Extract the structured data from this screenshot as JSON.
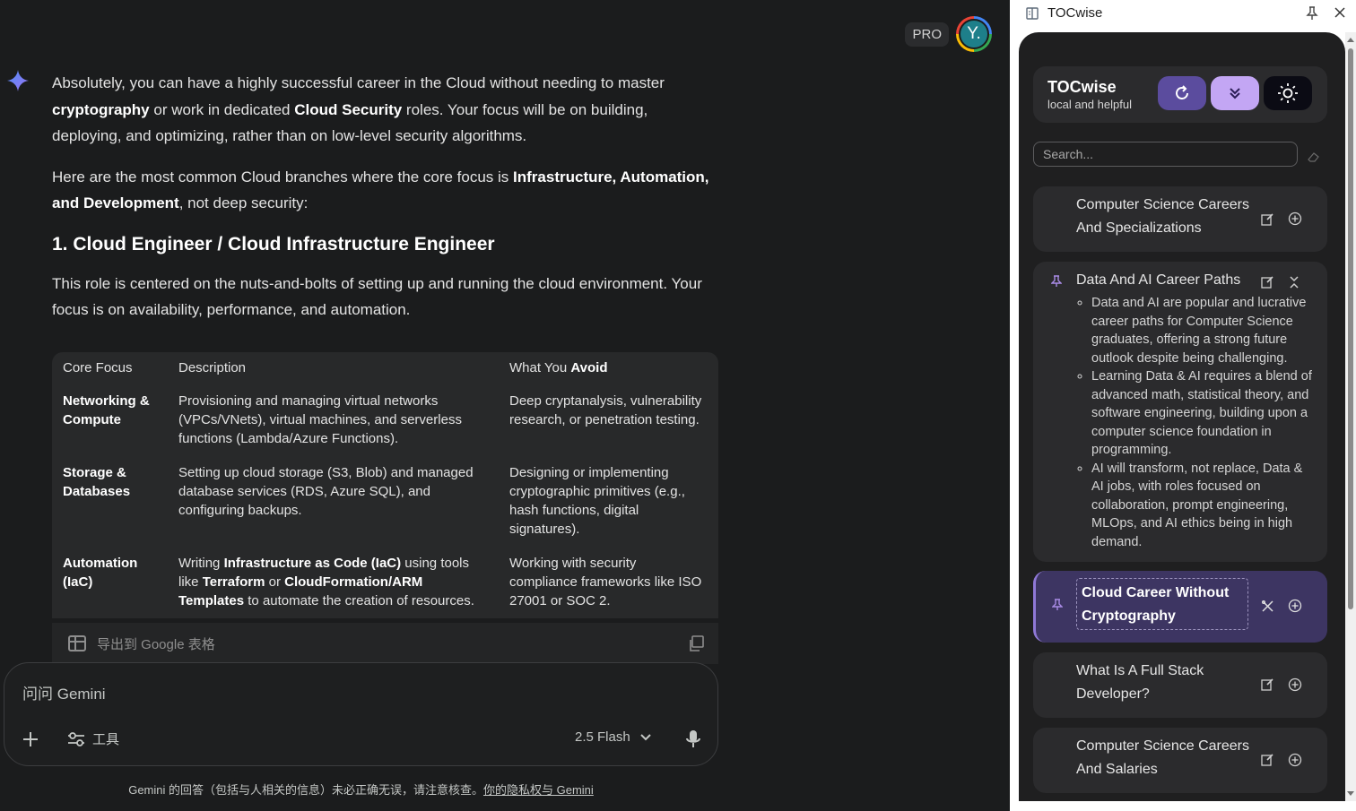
{
  "header": {
    "pro_badge": "PRO",
    "avatar_initial": "Y."
  },
  "response": {
    "p1_a": "Absolutely, you can have a highly successful career in the Cloud without needing to master ",
    "p1_b": "cryptography",
    "p1_c": " or work in dedicated ",
    "p1_d": "Cloud Security",
    "p1_e": " roles. Your focus will be on building, deploying, and optimizing, rather than on low-level security algorithms.",
    "p2_a": "Here are the most common Cloud branches where the core focus is ",
    "p2_b": "Infrastructure, Automation, and Development",
    "p2_c": ", not deep security:",
    "heading": "1. Cloud Engineer / Cloud Infrastructure Engineer",
    "p3": "This role is centered on the nuts-and-bolts of setting up and running the cloud environment. Your focus is on availability, performance, and automation."
  },
  "table": {
    "headers": [
      "Core Focus",
      "Description",
      "What You "
    ],
    "header_bold": "Avoid",
    "rows": [
      {
        "core": "Networking & Compute",
        "desc": "Provisioning and managing virtual networks (VPCs/VNets), virtual machines, and serverless functions (Lambda/Azure Functions).",
        "avoid": "Deep cryptanalysis, vulnerability research, or penetration testing."
      },
      {
        "core": "Storage & Databases",
        "desc": "Setting up cloud storage (S3, Blob) and managed database services (RDS, Azure SQL), and configuring backups.",
        "avoid": "Designing or implementing cryptographic primitives (e.g., hash functions, digital signatures)."
      },
      {
        "core": "Automation (IaC)",
        "desc_a": "Writing ",
        "desc_b": "Infrastructure as Code (IaC)",
        "desc_c": " using tools like ",
        "desc_d": "Terraform",
        "desc_e": " or ",
        "desc_f": "CloudFormation/ARM Templates",
        "desc_g": " to automate the creation of resources.",
        "avoid": "Working with security compliance frameworks like ISO 27001 or SOC 2."
      }
    ],
    "export_label": "导出到 Google 表格"
  },
  "composer": {
    "placeholder": "问问 Gemini",
    "tools_label": "工具",
    "model_label": "2.5 Flash"
  },
  "disclaimer": {
    "text": "Gemini 的回答（包括与人相关的信息）未必正确无误，请注意核查。",
    "link": "你的隐私权与 Gemini"
  },
  "panel": {
    "window_title": "TOCwise",
    "brand_title": "TOCwise",
    "brand_subtitle": "local and helpful",
    "search_placeholder": "Search...",
    "accent": "#5b4c9e",
    "items": [
      {
        "title": "Computer Science Careers And Specializations"
      },
      {
        "title": "Data And AI Career Paths",
        "bullets": [
          "Data and AI are popular and lucrative career paths for Computer Science graduates, offering a strong future outlook despite being challenging.",
          "Learning Data & AI requires a blend of advanced math, statistical theory, and software engineering, building upon a computer science foundation in programming.",
          "AI will transform, not replace, Data & AI jobs, with roles focused on collaboration, prompt engineering, MLOps, and AI ethics being in high demand."
        ]
      },
      {
        "title": "Cloud Career Without Cryptography"
      },
      {
        "title": "What Is A Full Stack Developer?"
      },
      {
        "title": "Computer Science Careers And Salaries"
      }
    ]
  }
}
